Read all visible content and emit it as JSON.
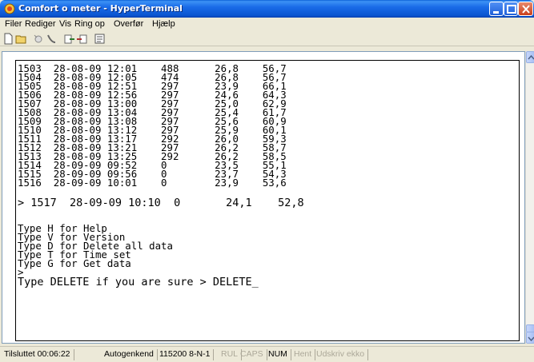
{
  "window": {
    "title": "Comfort o meter - HyperTerminal"
  },
  "menu": [
    "Filer",
    "Rediger",
    "Vis",
    "Ring op",
    "Overfør",
    "Hjælp"
  ],
  "toolbar": [
    "new-icon",
    "open-icon",
    "disconnect-icon",
    "call-icon",
    "send-icon",
    "receive-icon",
    "properties-icon"
  ],
  "terminal": {
    "lines": [
      "1503  28-08-09 12:01    488      26,8    56,7",
      "1504  28-08-09 12:05    474      26,8    56,7",
      "1505  28-08-09 12:51    297      23,9    66,1",
      "1506  28-08-09 12:56    297      24,6    64,3",
      "1507  28-08-09 13:00    297      25,0    62,9",
      "1508  28-08-09 13:04    297      25,4    61,7",
      "1509  28-08-09 13:08    297      25,6    60,9",
      "1510  28-08-09 13:12    297      25,9    60,1",
      "1511  28-08-09 13:17    292      26,0    59,3",
      "1512  28-08-09 13:21    297      26,2    58,7",
      "1513  28-08-09 13:25    292      26,2    58,5",
      "1514  28-09-09 09:52    0        23,5    55,1",
      "1515  28-09-09 09:56    0        23,7    54,3",
      "1516  28-09-09 10:01    0        23,9    53,6",
      "",
      "> 1517  28-09-09 10:10  0       24,1    52,8",
      "",
      "Type H for Help",
      "Type V for Version",
      "Type D for Delete all data",
      "Type T for Time set",
      "Type G for Get data",
      ">",
      "Type DELETE if you are sure > DELETE_"
    ]
  },
  "status": {
    "connected": "Tilsluttet 00:06:22",
    "autodetect": "Autogenkend",
    "baud": "115200 8-N-1",
    "scroll": "RUL",
    "caps": "CAPS",
    "num": "NUM",
    "capture": "Hent",
    "print_echo": "Udskriv ekko"
  },
  "colors": {
    "titlebar": "#0a55d0",
    "close": "#c9401c",
    "chrome": "#ece9d8"
  }
}
